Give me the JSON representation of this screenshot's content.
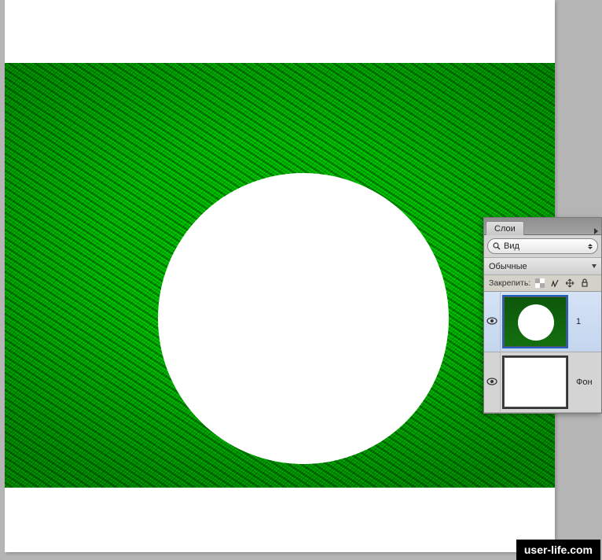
{
  "panel": {
    "tab": "Слои",
    "search_mode": "Вид",
    "section": "Обычные",
    "lock_label": "Закрепить:",
    "layers": [
      {
        "name": "1"
      },
      {
        "name": "Фон"
      }
    ]
  },
  "watermark": "user-life.com"
}
